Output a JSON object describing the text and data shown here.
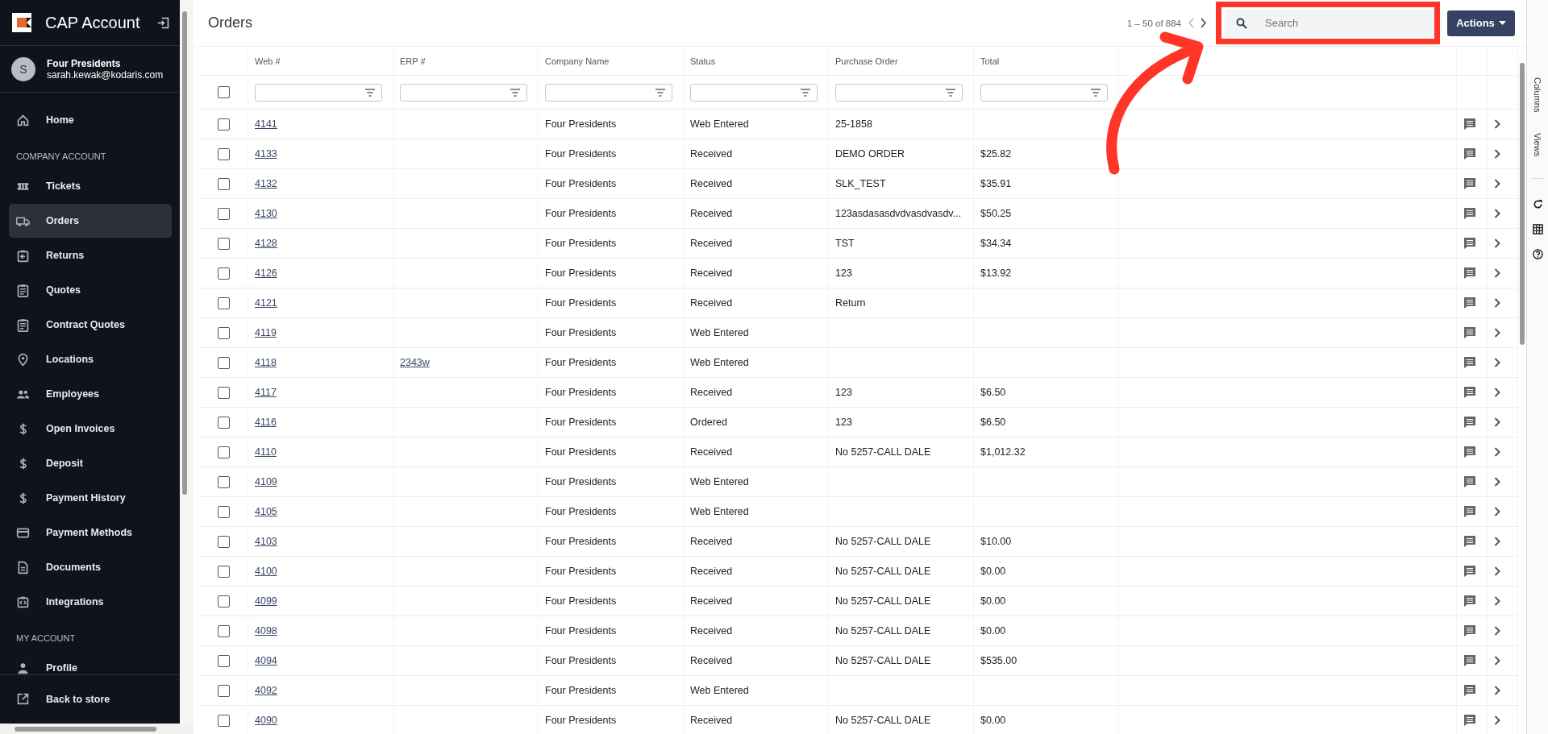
{
  "sidebar": {
    "title": "CAP Account",
    "account": {
      "initial": "S",
      "name": "Four Presidents",
      "email": "sarah.kewak@kodaris.com"
    },
    "sections": [
      {
        "items": [
          {
            "label": "Home",
            "selected": false
          }
        ]
      },
      {
        "heading": "COMPANY ACCOUNT",
        "items": [
          {
            "label": "Tickets",
            "selected": false
          },
          {
            "label": "Orders",
            "selected": true
          },
          {
            "label": "Returns",
            "selected": false
          },
          {
            "label": "Quotes",
            "selected": false
          },
          {
            "label": "Contract Quotes",
            "selected": false
          },
          {
            "label": "Locations",
            "selected": false
          },
          {
            "label": "Employees",
            "selected": false
          },
          {
            "label": "Open Invoices",
            "selected": false
          },
          {
            "label": "Deposit",
            "selected": false
          },
          {
            "label": "Payment History",
            "selected": false
          },
          {
            "label": "Payment Methods",
            "selected": false
          },
          {
            "label": "Documents",
            "selected": false
          },
          {
            "label": "Integrations",
            "selected": false
          }
        ]
      },
      {
        "heading": "MY ACCOUNT",
        "items": [
          {
            "label": "Profile",
            "selected": false
          }
        ]
      }
    ],
    "footer": {
      "label": "Back to store"
    }
  },
  "page": {
    "title": "Orders",
    "pagination": "1 – 50 of 884",
    "search": {
      "placeholder": "Search"
    },
    "actions": "Actions"
  },
  "table": {
    "select_all_checked": false,
    "columns": [
      "Web #",
      "ERP #",
      "Company Name",
      "Status",
      "Purchase Order",
      "Total"
    ],
    "rows": [
      {
        "checked": false,
        "web": "4141",
        "company": "Four Presidents",
        "status": "Web Entered",
        "po": "25-1858"
      },
      {
        "checked": false,
        "web": "4133",
        "company": "Four Presidents",
        "status": "Received",
        "po": "DEMO ORDER",
        "total": "$25.82"
      },
      {
        "checked": false,
        "web": "4132",
        "company": "Four Presidents",
        "status": "Received",
        "po": "SLK_TEST",
        "total": "$35.91"
      },
      {
        "checked": false,
        "web": "4130",
        "company": "Four Presidents",
        "status": "Received",
        "po": "123asdasasdvdvasdvasdv...",
        "total": "$50.25"
      },
      {
        "checked": false,
        "web": "4128",
        "company": "Four Presidents",
        "status": "Received",
        "po": "TST",
        "total": "$34.34"
      },
      {
        "checked": false,
        "web": "4126",
        "company": "Four Presidents",
        "status": "Received",
        "po": "123",
        "total": "$13.92"
      },
      {
        "checked": false,
        "web": "4121",
        "company": "Four Presidents",
        "status": "Received",
        "po": "Return"
      },
      {
        "checked": false,
        "web": "4119",
        "company": "Four Presidents",
        "status": "Web Entered"
      },
      {
        "checked": false,
        "web": "4118",
        "erp": "2343w",
        "company": "Four Presidents",
        "status": "Web Entered"
      },
      {
        "checked": false,
        "web": "4117",
        "company": "Four Presidents",
        "status": "Received",
        "po": "123",
        "total": "$6.50"
      },
      {
        "checked": false,
        "web": "4116",
        "company": "Four Presidents",
        "status": "Ordered",
        "po": "123",
        "total": "$6.50"
      },
      {
        "checked": false,
        "web": "4110",
        "company": "Four Presidents",
        "status": "Received",
        "po": "No 5257-CALL DALE",
        "total": "$1,012.32"
      },
      {
        "checked": false,
        "web": "4109",
        "company": "Four Presidents",
        "status": "Web Entered"
      },
      {
        "checked": false,
        "web": "4105",
        "company": "Four Presidents",
        "status": "Web Entered"
      },
      {
        "checked": false,
        "web": "4103",
        "company": "Four Presidents",
        "status": "Received",
        "po": "No 5257-CALL DALE",
        "total": "$10.00"
      },
      {
        "checked": false,
        "web": "4100",
        "company": "Four Presidents",
        "status": "Received",
        "po": "No 5257-CALL DALE",
        "total": "$0.00"
      },
      {
        "checked": false,
        "web": "4099",
        "company": "Four Presidents",
        "status": "Received",
        "po": "No 5257-CALL DALE",
        "total": "$0.00"
      },
      {
        "checked": false,
        "web": "4098",
        "company": "Four Presidents",
        "status": "Received",
        "po": "No 5257-CALL DALE",
        "total": "$0.00"
      },
      {
        "checked": false,
        "web": "4094",
        "company": "Four Presidents",
        "status": "Received",
        "po": "No 5257-CALL DALE",
        "total": "$535.00"
      },
      {
        "checked": false,
        "web": "4092",
        "company": "Four Presidents",
        "status": "Web Entered"
      },
      {
        "checked": false,
        "web": "4090",
        "company": "Four Presidents",
        "status": "Received",
        "po": "No 5257-CALL DALE",
        "total": "$0.00"
      }
    ]
  },
  "right_rail": {
    "tabs": [
      "Columns",
      "Views"
    ]
  }
}
